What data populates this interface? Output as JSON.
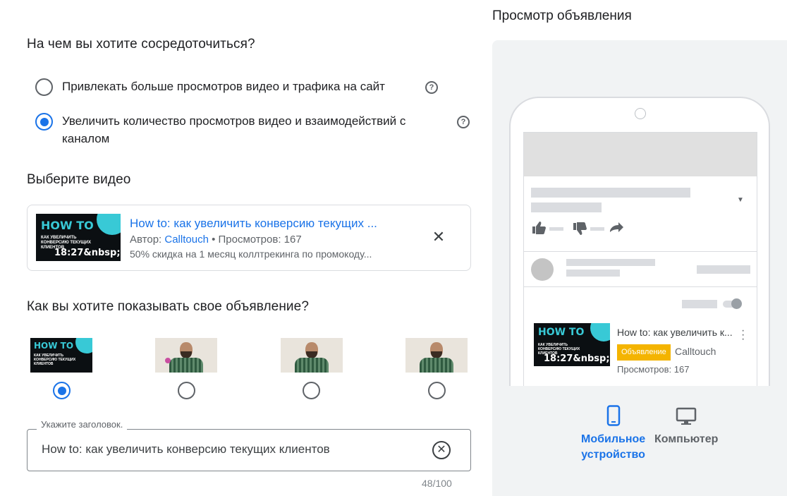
{
  "focus": {
    "heading": "На чем вы хотите сосредоточиться?",
    "options": [
      {
        "label": "Привлекать больше просмотров видео и трафика на сайт",
        "selected": false
      },
      {
        "label_line1": "Увеличить количество просмотров видео и взаимодействий с",
        "label_line2": "каналом",
        "selected": true
      }
    ]
  },
  "video": {
    "heading": "Выберите видео",
    "thumb": {
      "how_to": "HOW TO",
      "subtitle": "как увеличить конверсию текущих клиентов",
      "duration": "18:27&nbsp;"
    },
    "title": "How to: как увеличить конверсию текущих ...",
    "author_prefix": "Автор: ",
    "author": "Calltouch",
    "views": " • Просмотров: 167",
    "description": "50% скидка на 1 месяц коллтрекинга по промокоду..."
  },
  "display": {
    "heading": "Как вы хотите показывать свое объявление?",
    "thumbnails": [
      {
        "kind": "title-card",
        "selected": true
      },
      {
        "kind": "person-gesture",
        "selected": false
      },
      {
        "kind": "person",
        "selected": false
      },
      {
        "kind": "person",
        "selected": false
      }
    ]
  },
  "headline": {
    "label": "Укажите заголовок.",
    "value": "How to: как увеличить конверсию текущих клиентов",
    "counter": "48/100"
  },
  "preview": {
    "title": "Просмотр объявления",
    "ad": {
      "title": "How to: как увеличить к...",
      "badge": "Объявление",
      "channel": "Calltouch",
      "views": "Просмотров: 167"
    },
    "devices": [
      {
        "label_line1": "Мобильное",
        "label_line2": "устройство",
        "icon": "smartphone-icon",
        "active": true
      },
      {
        "label_line1": "Компьютер",
        "label_line2": "",
        "icon": "desktop-icon",
        "active": false
      }
    ]
  },
  "colors": {
    "accent": "#1a73e8",
    "badge": "#f4b400",
    "panel": "#f1f3f4",
    "brand_teal": "#38c9d6"
  }
}
